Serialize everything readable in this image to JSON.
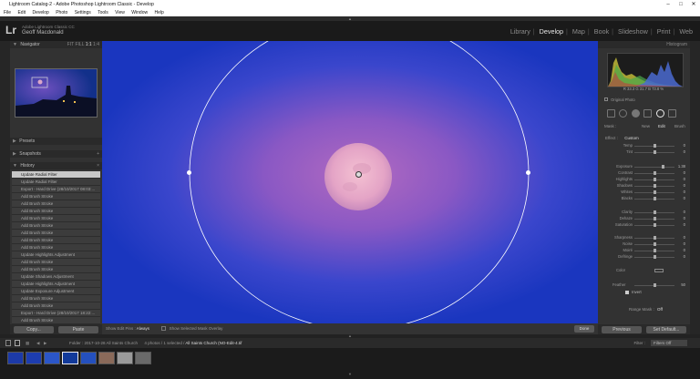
{
  "window": {
    "title": "Lightroom Catalog-2 - Adobe Photoshop Lightroom Classic - Develop",
    "controls": [
      "–",
      "□",
      "✕"
    ]
  },
  "menu": [
    "File",
    "Edit",
    "Develop",
    "Photo",
    "Settings",
    "Tools",
    "View",
    "Window",
    "Help"
  ],
  "identity": {
    "logo": "Lr",
    "product": "Adobe Lightroom Classic CC",
    "user": "Geoff Macdonald"
  },
  "modules": [
    {
      "label": "Library",
      "active": false
    },
    {
      "label": "Develop",
      "active": true
    },
    {
      "label": "Map",
      "active": false
    },
    {
      "label": "Book",
      "active": false
    },
    {
      "label": "Slideshow",
      "active": false
    },
    {
      "label": "Print",
      "active": false
    },
    {
      "label": "Web",
      "active": false
    }
  ],
  "left_panel": {
    "navigator": {
      "label": "Navigator",
      "zoom": [
        "FIT",
        "FILL",
        "1:1",
        "1:4"
      ]
    },
    "presets": {
      "label": "Presets"
    },
    "snapshots": {
      "label": "Snapshots",
      "add": "+"
    },
    "history": {
      "label": "History",
      "clear": "×",
      "items": [
        "Update Radial Filter",
        "Update Radial Filter",
        "Export - Hard Drive (28/10/2017 08:03:...",
        "Add Brush Stroke",
        "Add Brush Stroke",
        "Add Brush Stroke",
        "Add Brush Stroke",
        "Add Brush Stroke",
        "Add Brush Stroke",
        "Add Brush Stroke",
        "Add Brush Stroke",
        "Update Highlights Adjustment",
        "Add Brush Stroke",
        "Add Brush Stroke",
        "Update Shadows Adjustment",
        "Update Highlights Adjustment",
        "Update Exposure Adjustment",
        "Add Brush Stroke",
        "Add Brush Stroke",
        "Export - Hard Drive (28/10/2017 18:22:...",
        "Add Brush Stroke",
        "Add Brush Stroke"
      ]
    },
    "copy_label": "Copy...",
    "paste_label": "Paste"
  },
  "toolbar": {
    "overlay_label": "Show Edit Pins :",
    "overlay_value": "Always",
    "show_overlay": "Show Selected Mask Overlay",
    "done_label": "Done"
  },
  "right_panel": {
    "histogram": {
      "label": "Histogram",
      "readout": [
        "R",
        "33.3",
        "G",
        "31.7",
        "B",
        "73.8",
        "%"
      ],
      "original_photo": "Original Photo"
    },
    "mask": {
      "label": "Mask :",
      "new": "New",
      "edit": "Edit",
      "brush": "Brush"
    },
    "effect": {
      "label": "Effect :",
      "value": "Custom"
    },
    "sliders": [
      {
        "label": "Temp",
        "value": "0",
        "knob": 0.5
      },
      {
        "label": "Tint",
        "value": "0",
        "knob": 0.5
      },
      {
        "label": "Exposure",
        "value": "1.38",
        "knob": 0.72
      },
      {
        "label": "Contrast",
        "value": "0",
        "knob": 0.5
      },
      {
        "label": "Highlights",
        "value": "0",
        "knob": 0.5
      },
      {
        "label": "Shadows",
        "value": "0",
        "knob": 0.5
      },
      {
        "label": "Whites",
        "value": "0",
        "knob": 0.5
      },
      {
        "label": "Blacks",
        "value": "0",
        "knob": 0.5
      },
      {
        "label": "Clarity",
        "value": "0",
        "knob": 0.5
      },
      {
        "label": "Dehaze",
        "value": "0",
        "knob": 0.5
      },
      {
        "label": "Saturation",
        "value": "0",
        "knob": 0.5
      },
      {
        "label": "Sharpness",
        "value": "0",
        "knob": 0.5
      },
      {
        "label": "Noise",
        "value": "0",
        "knob": 0.5
      },
      {
        "label": "Moiré",
        "value": "0",
        "knob": 0.5
      },
      {
        "label": "Defringe",
        "value": "0",
        "knob": 0.5
      }
    ],
    "color_label": "Color",
    "feather": {
      "label": "Feather",
      "value": "50",
      "knob": 0.5
    },
    "invert": "Invert",
    "range_mask": {
      "label": "Range Mask :",
      "value": "Off"
    },
    "previous_label": "Previous",
    "reset_label": "Set Default..."
  },
  "filmstrip": {
    "info_prefix": "Folder : 2017-10-28 All Saints Church",
    "info_count": "4 photos / 1 selected /",
    "info_file": "All Saints Church (NO-Edit-4.tif",
    "filter_label": "Filter :",
    "filter_value": "Filters Off",
    "thumbs": [
      {
        "color": "#1c3aa8"
      },
      {
        "color": "#1d3db0"
      },
      {
        "color": "#2b56c8"
      },
      {
        "color": "#123a9a"
      },
      {
        "color": "#2450be"
      },
      {
        "color": "#8a6a5a"
      },
      {
        "color": "#9a9a9a"
      },
      {
        "color": "#6a6a6a"
      }
    ],
    "selected_index": 3
  },
  "collapse_arrows": {
    "top": "▲",
    "bottom": "▼"
  }
}
